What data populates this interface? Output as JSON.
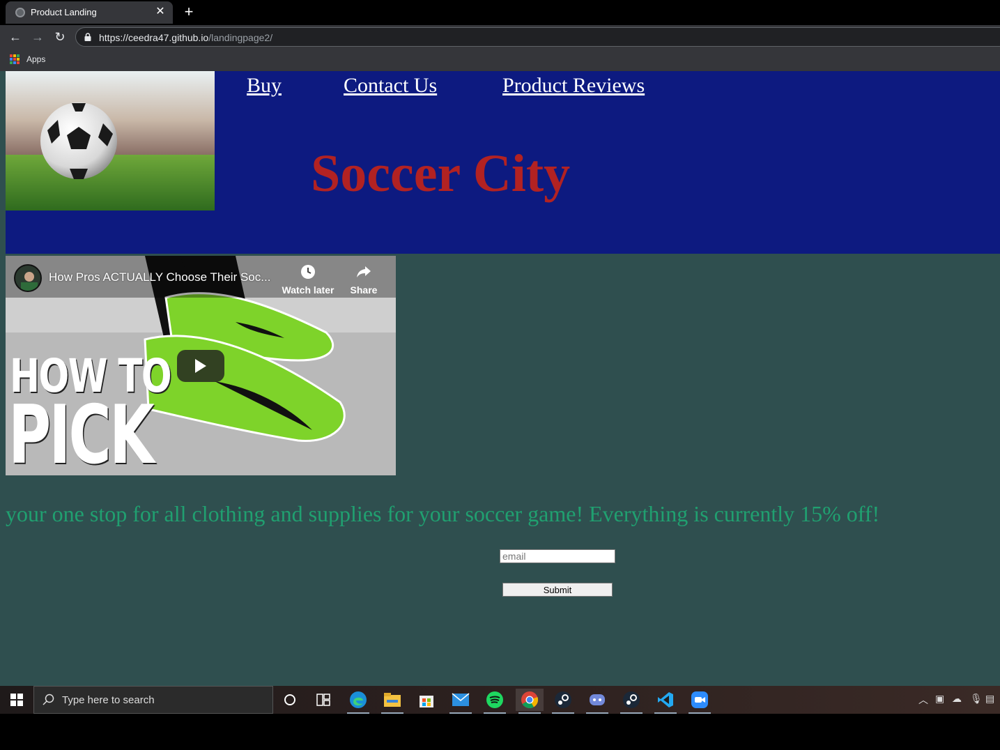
{
  "browser": {
    "tab_title": "Product Landing",
    "url_host": "https://ceedra47.github.io",
    "url_path": "/landingpage2/",
    "bookmarks_apps_label": "Apps"
  },
  "header": {
    "nav": [
      "Buy",
      "Contact Us",
      "Product Reviews"
    ],
    "brand": "Soccer City"
  },
  "video": {
    "title": "How Pros ACTUALLY Choose Their Soc...",
    "watch_later": "Watch later",
    "share": "Share",
    "thumb_line1": "HOW TO",
    "thumb_line2": "PICK"
  },
  "main": {
    "tagline": "your one stop for all clothing and supplies for your soccer game! Everything is currently 15% off!",
    "email_placeholder": "email",
    "submit_label": "Submit"
  },
  "taskbar": {
    "search_placeholder": "Type here to search"
  }
}
